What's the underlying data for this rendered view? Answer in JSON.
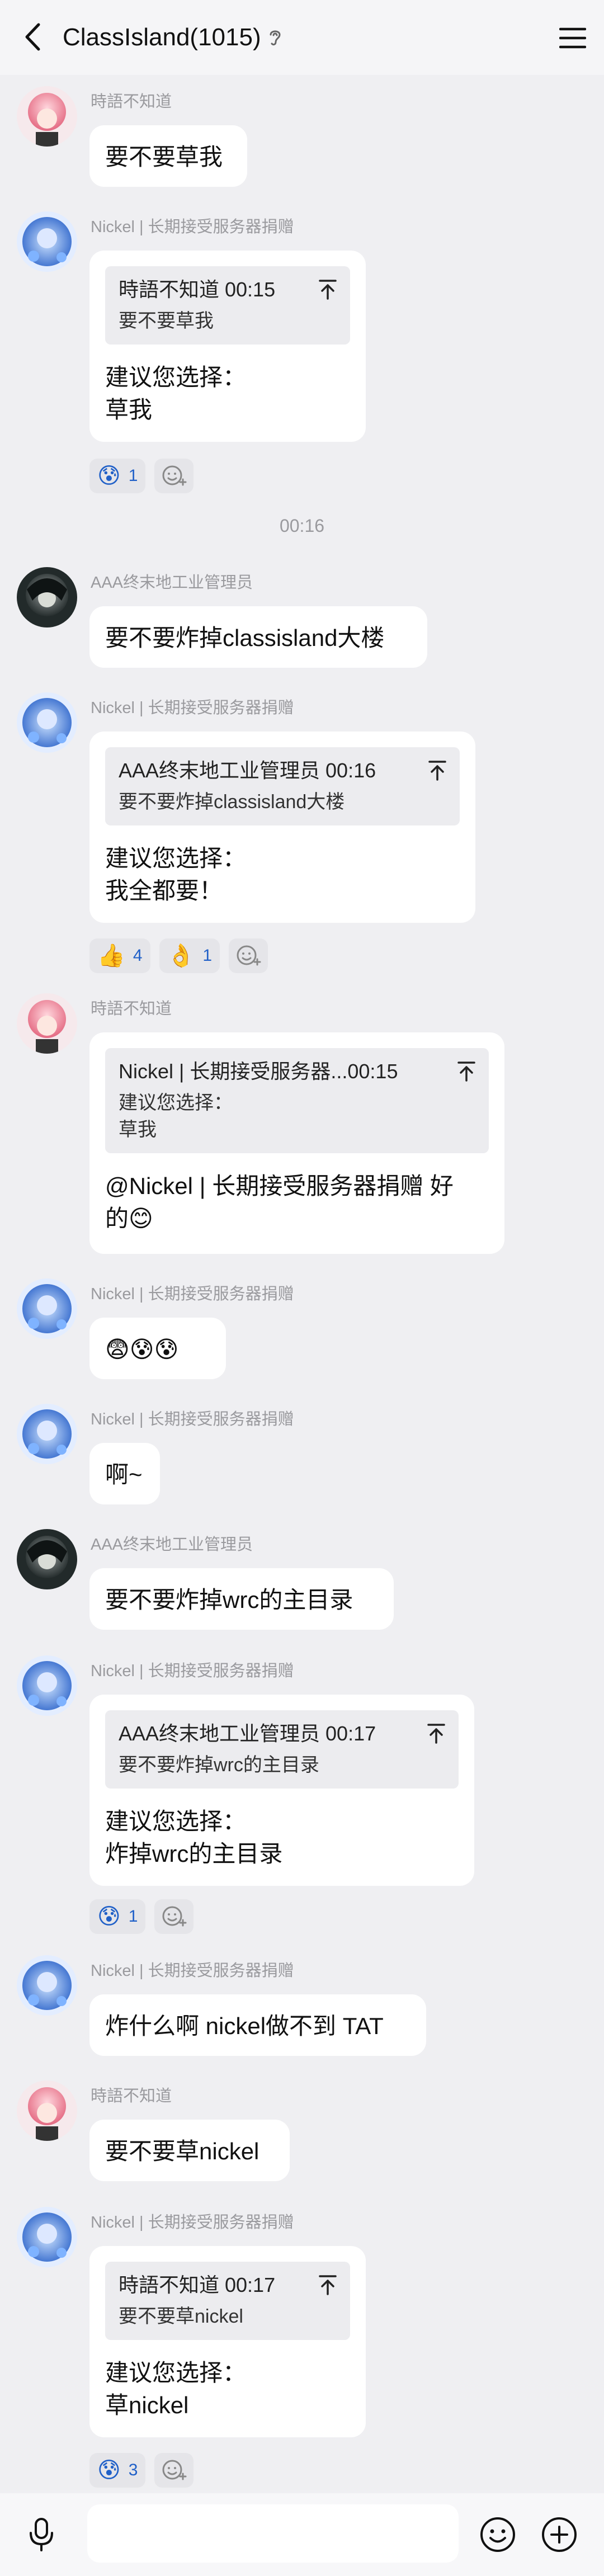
{
  "header": {
    "title": "ClassIsland(1015)",
    "back_icon": "chevron-left-icon",
    "menu_icon": "hamburger-menu-icon",
    "badge_icon": "ear-icon"
  },
  "messages": [
    {
      "sender": "時語不知道",
      "text": [
        "要不要草我"
      ]
    },
    {
      "sender": "Nickel | 长期接受服务器捐赠",
      "quote": {
        "head": "時語不知道 00:15",
        "body": [
          "要不要草我"
        ]
      },
      "text": [
        "建议您选择：",
        "草我"
      ],
      "reactions": [
        {
          "emoji": "😰",
          "count": "1"
        }
      ]
    },
    {
      "sender": "AAA终末地工业管理员",
      "text": [
        "要不要炸掉classisland大楼"
      ]
    },
    {
      "sender": "Nickel | 长期接受服务器捐赠",
      "quote": {
        "head": "AAA终末地工业管理员 00:16",
        "body": [
          "要不要炸掉classisland大楼"
        ]
      },
      "text": [
        "建议您选择：",
        "我全都要！"
      ],
      "reactions": [
        {
          "emoji": "👍",
          "count": "4"
        },
        {
          "emoji": "👌",
          "count": "1"
        }
      ]
    },
    {
      "sender": "時語不知道",
      "quote": {
        "head": "Nickel | 长期接受服务器...00:15",
        "body": [
          "建议您选择：",
          "草我"
        ]
      },
      "text": [
        "@Nickel | 长期接受服务器捐赠 好",
        "的😊"
      ]
    },
    {
      "sender": "Nickel | 长期接受服务器捐赠",
      "text": [
        "😨😰😰"
      ]
    },
    {
      "sender": "Nickel | 长期接受服务器捐赠",
      "text": [
        "啊~"
      ]
    },
    {
      "sender": "AAA终末地工业管理员",
      "text": [
        "要不要炸掉wrc的主目录"
      ]
    },
    {
      "sender": "Nickel | 长期接受服务器捐赠",
      "quote": {
        "head": "AAA终末地工业管理员 00:17",
        "body": [
          "要不要炸掉wrc的主目录"
        ]
      },
      "text": [
        "建议您选择：",
        "炸掉wrc的主目录"
      ],
      "reactions": [
        {
          "emoji": "😰",
          "count": "1"
        }
      ]
    },
    {
      "sender": "Nickel | 长期接受服务器捐赠",
      "text": [
        "炸什么啊 nickel做不到 TAT"
      ]
    },
    {
      "sender": "時語不知道",
      "text": [
        "要不要草nickel"
      ]
    },
    {
      "sender": "Nickel | 长期接受服务器捐赠",
      "quote": {
        "head": "時語不知道 00:17",
        "body": [
          "要不要草nickel"
        ]
      },
      "text": [
        "建议您选择：",
        "草nickel"
      ],
      "reactions": [
        {
          "emoji": "😰",
          "count": "3"
        }
      ]
    }
  ],
  "timestamp": "00:16",
  "input": {
    "placeholder": "",
    "value": ""
  },
  "icons": {
    "mic": "microphone-icon",
    "emoji": "smiley-icon",
    "plus": "plus-circle-icon",
    "add_reaction": "add-reaction-icon",
    "quote_jump": "arrow-up-to-line-icon"
  },
  "colors": {
    "background": "#efeff2",
    "bubble": "#ffffff",
    "quote_bg": "#ececef",
    "reaction_count": "#2060c8",
    "sender": "#9a9a9e"
  }
}
